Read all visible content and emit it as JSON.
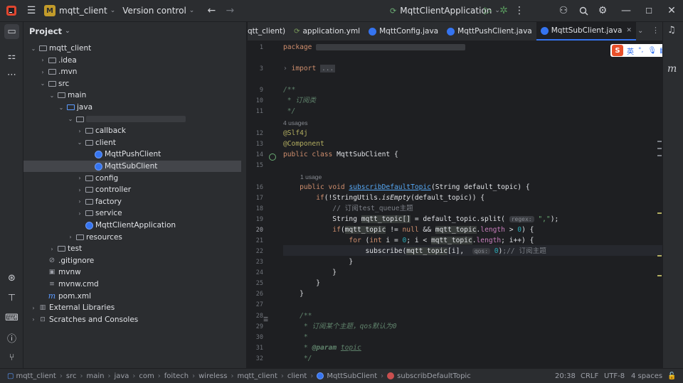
{
  "titlebar": {
    "project_badge": "M",
    "project_name": "mqtt_client",
    "vcs": "Version control",
    "run_config": "MqttClientApplication"
  },
  "project_panel": {
    "title": "Project",
    "tree": [
      {
        "label": "mqtt_client",
        "indent": 0,
        "arrow": "v",
        "icon": "folder"
      },
      {
        "label": ".idea",
        "indent": 1,
        "arrow": ">",
        "icon": "folder"
      },
      {
        "label": ".mvn",
        "indent": 1,
        "arrow": ">",
        "icon": "folder"
      },
      {
        "label": "src",
        "indent": 1,
        "arrow": "v",
        "icon": "folder"
      },
      {
        "label": "main",
        "indent": 2,
        "arrow": "v",
        "icon": "folder"
      },
      {
        "label": "java",
        "indent": 3,
        "arrow": "v",
        "icon": "folder-blue"
      },
      {
        "label": "",
        "indent": 4,
        "arrow": "v",
        "icon": "folder",
        "blurred": true
      },
      {
        "label": "callback",
        "indent": 5,
        "arrow": ">",
        "icon": "folder"
      },
      {
        "label": "client",
        "indent": 5,
        "arrow": "v",
        "icon": "folder"
      },
      {
        "label": "MqttPushClient",
        "indent": 6,
        "arrow": "",
        "icon": "class"
      },
      {
        "label": "MqttSubClient",
        "indent": 6,
        "arrow": "",
        "icon": "class",
        "selected": true
      },
      {
        "label": "config",
        "indent": 5,
        "arrow": ">",
        "icon": "folder"
      },
      {
        "label": "controller",
        "indent": 5,
        "arrow": ">",
        "icon": "folder"
      },
      {
        "label": "factory",
        "indent": 5,
        "arrow": ">",
        "icon": "folder"
      },
      {
        "label": "service",
        "indent": 5,
        "arrow": ">",
        "icon": "folder"
      },
      {
        "label": "MqttClientApplication",
        "indent": 5,
        "arrow": "",
        "icon": "class"
      },
      {
        "label": "resources",
        "indent": 4,
        "arrow": ">",
        "icon": "folder"
      },
      {
        "label": "test",
        "indent": 2,
        "arrow": ">",
        "icon": "folder"
      },
      {
        "label": ".gitignore",
        "indent": 1,
        "arrow": "",
        "icon": "circle"
      },
      {
        "label": "mvnw",
        "indent": 1,
        "arrow": "",
        "icon": "file"
      },
      {
        "label": "mvnw.cmd",
        "indent": 1,
        "arrow": "",
        "icon": "lines"
      },
      {
        "label": "pom.xml",
        "indent": 1,
        "arrow": "",
        "icon": "m"
      },
      {
        "label": "External Libraries",
        "indent": 0,
        "arrow": ">",
        "icon": "lib"
      },
      {
        "label": "Scratches and Consoles",
        "indent": 0,
        "arrow": ">",
        "icon": "scratch"
      }
    ]
  },
  "tabs": [
    {
      "label": "qtt_client)",
      "icon": ""
    },
    {
      "label": "application.yml",
      "icon": "yml"
    },
    {
      "label": "MqttConfig.java",
      "icon": "class"
    },
    {
      "label": "MqttPushClient.java",
      "icon": "class"
    },
    {
      "label": "MqttSubClient.java",
      "icon": "class",
      "active": true
    }
  ],
  "code": {
    "line_numbers": [
      "1",
      "",
      "3",
      "",
      "9",
      "10",
      "11",
      "",
      "12",
      "13",
      "14",
      "15",
      "",
      "16",
      "17",
      "18",
      "19",
      "20",
      "21",
      "22",
      "23",
      "24",
      "25",
      "26",
      "27",
      "28",
      "29",
      "30",
      "31",
      "32"
    ],
    "usages_4": "4 usages",
    "usages_1": "1 usage",
    "comment_class": "* 订阅类",
    "comment_topic": "// 订阅test_queue主题",
    "comment_sub": ";// 订阅主题",
    "comment_doc1": "* 订阅某个主题，qos默认为0",
    "param_hint_regex": "regex:",
    "param_hint_qos": "qos:"
  },
  "ime": {
    "label": "英"
  },
  "statusbar": {
    "breadcrumbs": [
      "mqtt_client",
      "src",
      "main",
      "java",
      "com",
      "foitech",
      "wireless",
      "mqtt_client",
      "client",
      "MqttSubClient",
      "subscribDefaultTopic"
    ],
    "position": "20:38",
    "line_sep": "CRLF",
    "encoding": "UTF-8",
    "indent": "4 spaces"
  }
}
